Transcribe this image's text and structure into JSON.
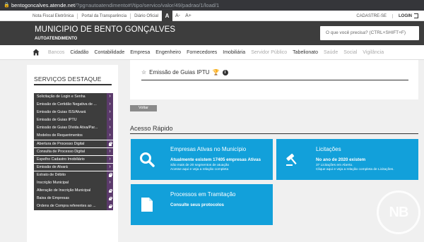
{
  "browser": {
    "host": "bentogoncalves.atende.net",
    "path": "/?pg=autoatendimento#!/tipo/servico/valor/49/padrao/1/load/1"
  },
  "utility": {
    "links": [
      "Nota Fiscal Eletrônica",
      "Portal da Transparência",
      "Diário Oficial"
    ],
    "a11y": [
      "A",
      "A-",
      "A+"
    ],
    "cadastre": "CADASTRE-SE",
    "login": "LOGIN"
  },
  "header": {
    "title": "MUNICIPIO DE BENTO GONÇALVES",
    "subtitle": "AUTOATENDIMENTO",
    "search_placeholder": "O que você precisa? (CTRL+SHIFT+F)"
  },
  "nav": {
    "items": [
      {
        "label": "Bancos",
        "dim": true
      },
      {
        "label": "Cidadão",
        "dim": false
      },
      {
        "label": "Contabilidade",
        "dim": false
      },
      {
        "label": "Empresa",
        "dim": false
      },
      {
        "label": "Engenheiro",
        "dim": false
      },
      {
        "label": "Fornecedores",
        "dim": false
      },
      {
        "label": "Imobiliária",
        "dim": false
      },
      {
        "label": "Servidor Público",
        "dim": true
      },
      {
        "label": "Tabelionato",
        "dim": false
      },
      {
        "label": "Saúde",
        "dim": true
      },
      {
        "label": "Social",
        "dim": true
      },
      {
        "label": "Vigilância",
        "dim": true
      }
    ]
  },
  "sidebar": {
    "heading": "SERVIÇOS DESTAQUE",
    "items": [
      {
        "label": "Solicitação de Login e Senha",
        "icon": "arrow"
      },
      {
        "label": "Emissão de Certidão Negativa de ...",
        "icon": "arrow"
      },
      {
        "label": "Emissão de Guias ISS/Alvará",
        "icon": "arrow"
      },
      {
        "label": "Emissão de Guias IPTU",
        "icon": "arrow"
      },
      {
        "label": "Emissão de Guias Dívida Ativa/Par...",
        "icon": "arrow"
      },
      {
        "label": "Modelos de Requerimentos",
        "icon": "arrow"
      },
      {
        "label": "Abertura de Processo Digital",
        "icon": "lock"
      },
      {
        "label": "Consulta de Processo Digital",
        "icon": "arrow"
      },
      {
        "label": "Espelho Cadastro Imobiliário",
        "icon": "arrow"
      },
      {
        "label": "Emissão de Alvará",
        "icon": "arrow"
      },
      {
        "label": "Extrato de Débito",
        "icon": "lock"
      },
      {
        "label": "Inscrição Municipal",
        "icon": "arrow"
      },
      {
        "label": "Alteração de Inscrição Municipal",
        "icon": "lock"
      },
      {
        "label": "Baixa de Empresas",
        "icon": "lock"
      },
      {
        "label": "Ordens de Compra referentes ao ...",
        "icon": "lock"
      }
    ]
  },
  "main": {
    "service_title": "Emissão de Guias IPTU",
    "back_label": "Voltar",
    "quick_heading": "Acesso Rápido",
    "tiles": [
      {
        "title": "Empresas Ativas no Município",
        "line2": "Atualmente existem 17405 empresas Ativas",
        "line3a": "São mais de 20 segmentos de atuação",
        "line3b": "Acesse aqui e veja a relação completa",
        "icon": "search-icon"
      },
      {
        "title": "Licitações",
        "line2": "No ano de 2020 existem",
        "line3a": "37 Licitações em Aberto.",
        "line3b": "Clique aqui e veja a relação completa de Licitações.",
        "icon": "gavel-icon"
      },
      {
        "title": "Processos em Tramitação",
        "line2": "Consulte seus protocolos",
        "icon": "document-icon"
      }
    ]
  },
  "watermark": "NB",
  "colors": {
    "dark": "#3d3d3d",
    "accent": "#12a0da",
    "purple": "#5b3a6b"
  }
}
